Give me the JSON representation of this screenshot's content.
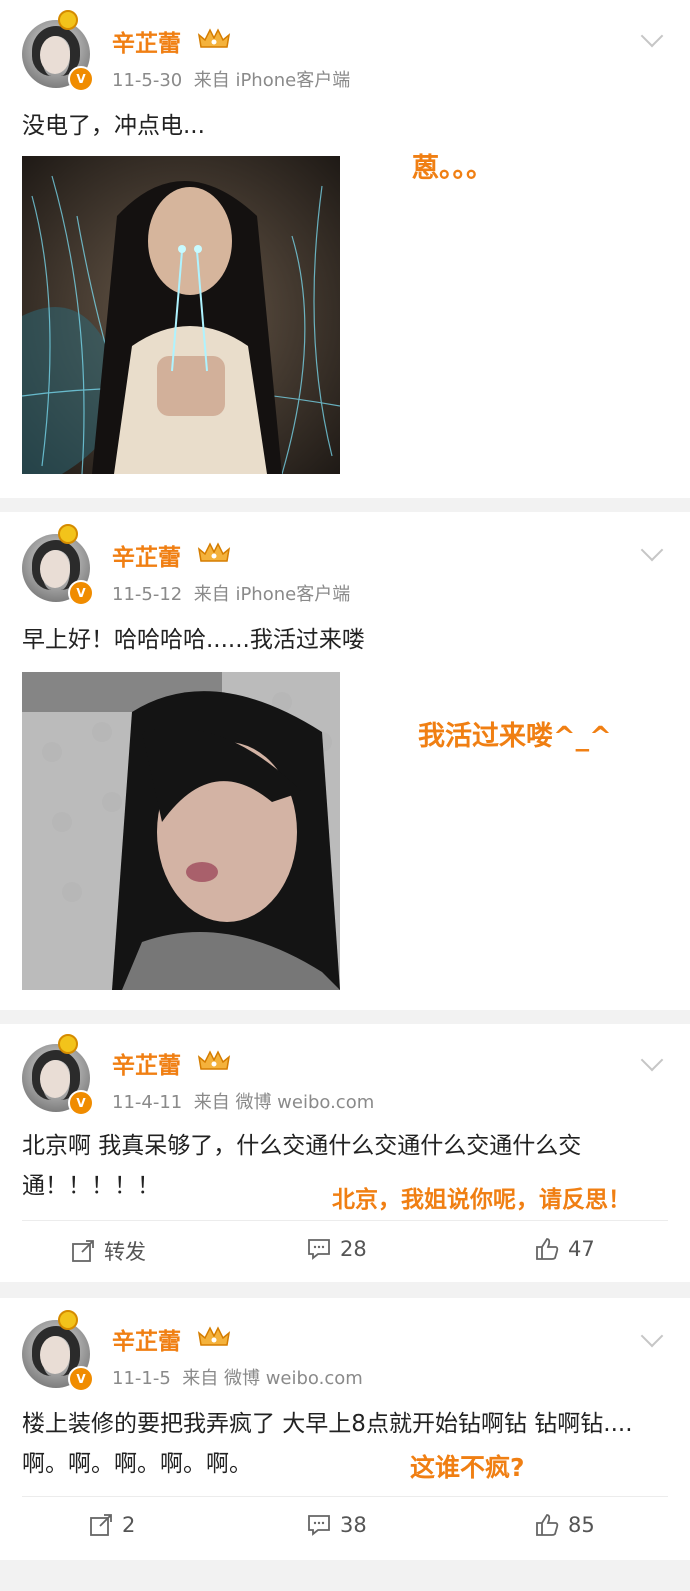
{
  "colors": {
    "accent": "#f07f13",
    "meta": "#8a8a8a",
    "text": "#222222"
  },
  "posts": [
    {
      "author": "辛芷蕾",
      "date": "11-5-30",
      "source": "来自 iPhone客户端",
      "text": "没电了，冲点电...",
      "overlay": "蒽。。。"
    },
    {
      "author": "辛芷蕾",
      "date": "11-5-12",
      "source": "来自 iPhone客户端",
      "text": "早上好！哈哈哈哈......我活过来喽",
      "overlay": "我活过来喽^_^"
    },
    {
      "author": "辛芷蕾",
      "date": "11-4-11",
      "source": "来自 微博 weibo.com",
      "text": "北京啊  我真呆够了，什么交通什么交通什么交通什么交通！！！！！",
      "overlay": "北京，我姐说你呢，请反思！",
      "actions": {
        "repost": "转发",
        "comments": "28",
        "likes": "47"
      }
    },
    {
      "author": "辛芷蕾",
      "date": "11-1-5",
      "source": "来自 微博 weibo.com",
      "text": "楼上装修的要把我弄疯了  大早上8点就开始钻啊钻 钻啊钻....啊。啊。啊。啊。啊。",
      "overlay": "这谁不疯?",
      "actions": {
        "repost": "2",
        "comments": "38",
        "likes": "85"
      }
    }
  ]
}
